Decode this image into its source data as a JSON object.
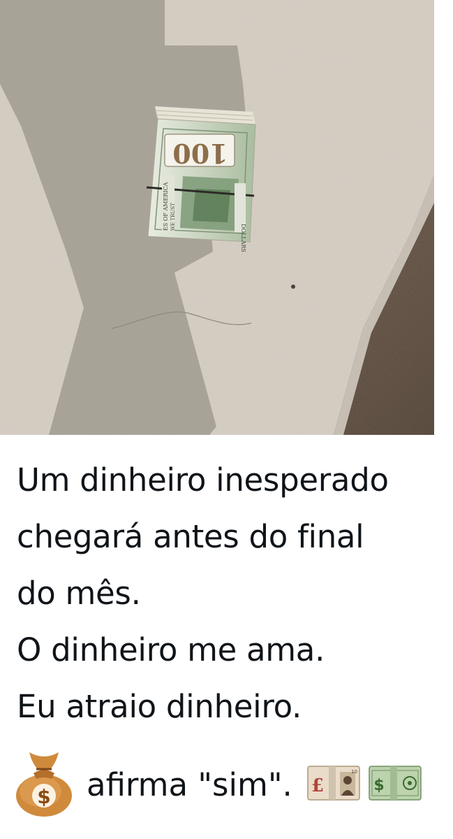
{
  "photo": {
    "bill_denomination": "100",
    "bill_side_text_1": "ES OF AMERICA",
    "bill_side_text_2": "WE TRUST",
    "bill_side_text_3": "DOLLARS"
  },
  "caption": {
    "lines": [
      "Um dinheiro inesperado",
      "chegará antes do final",
      "do mês.",
      "O dinheiro me ama.",
      "Eu atraio dinheiro."
    ]
  },
  "affirmation": {
    "prefix_icon": "money-bag-icon",
    "text": "afirma \"sim\".",
    "suffix_icons": [
      "pound-banknote-icon",
      "dollar-banknote-icon"
    ]
  },
  "colors": {
    "text": "#0f1419",
    "concrete_light": "#d9d2c8",
    "concrete_shadow": "#9d978e",
    "soil": "#6e5d4d",
    "banknote_green": "#9fb69a"
  }
}
